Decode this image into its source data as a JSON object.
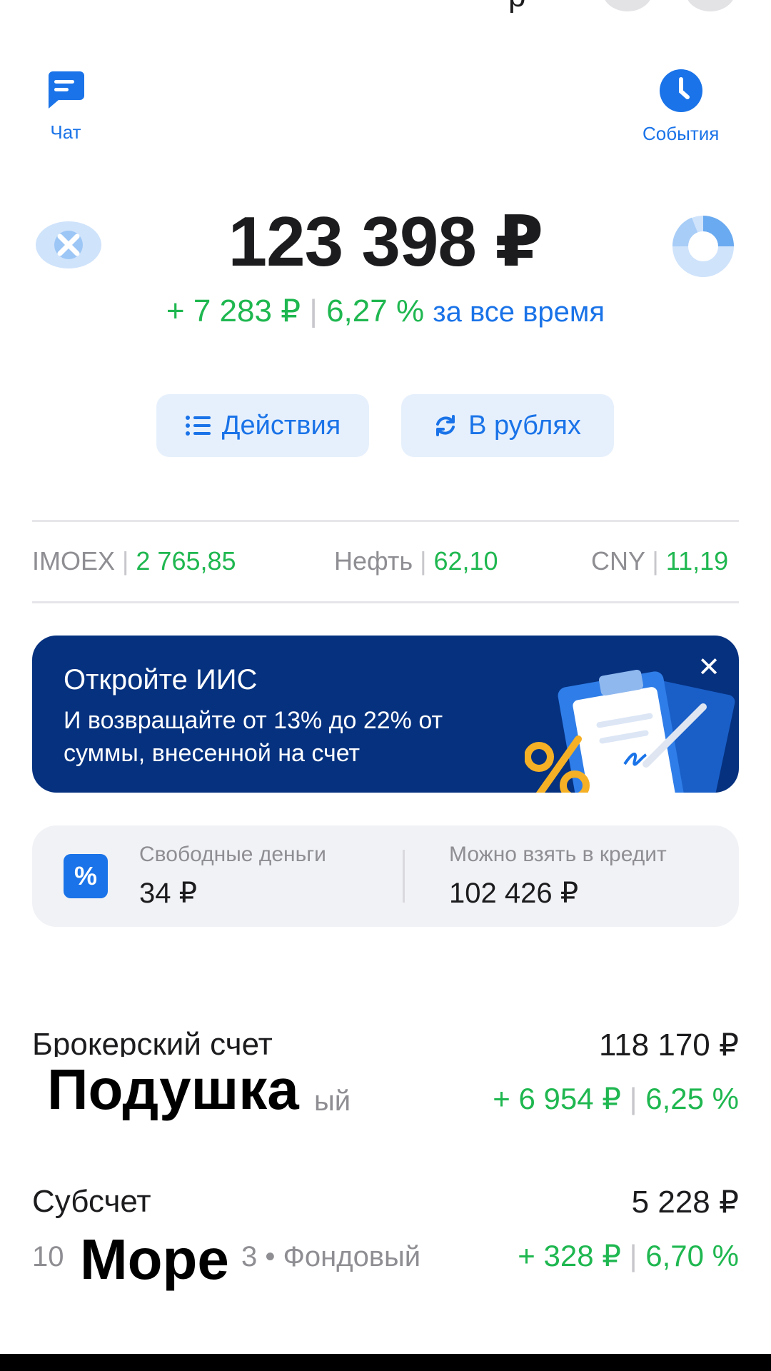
{
  "header": {
    "chat_label": "Чат",
    "events_label": "События",
    "top_glyph": "р"
  },
  "portfolio": {
    "balance": "123 398 ₽",
    "gain_amount": "+ 7 283 ₽",
    "gain_percent": "6,27 %",
    "period": "за все время"
  },
  "actions": {
    "actions_label": "Действия",
    "currency_label": "В рублях"
  },
  "tickers": [
    {
      "name": "IMOEX",
      "value": "2 765,85"
    },
    {
      "name": "Нефть",
      "value": "62,10"
    },
    {
      "name": "CNY",
      "value": "11,19"
    }
  ],
  "banner": {
    "title": "Откройте ИИС",
    "text": "И возвращайте от 13% до 22% от суммы, внесенной на счет",
    "close": "✕"
  },
  "cash": {
    "free_label": "Свободные деньги",
    "free_value": "34 ₽",
    "credit_label": "Можно взять в кредит",
    "credit_value": "102 426 ₽"
  },
  "accounts": [
    {
      "title": "Брокерский счет",
      "overlay": "Подушка",
      "sub_tail": "ый",
      "value": "118 170 ₽",
      "gain": "+ 6 954 ₽",
      "gain_percent": "6,25 %"
    },
    {
      "title": "Субсчет",
      "overlay": "Море",
      "sub_head": "10",
      "sub_tail": "3 • Фондовый",
      "value": "5 228 ₽",
      "gain": "+ 328 ₽",
      "gain_percent": "6,70 %"
    }
  ],
  "colors": {
    "accent": "#1a73e8",
    "positive": "#1fb750",
    "banner_bg": "#05317f",
    "card_bg": "#f1f2f6"
  }
}
